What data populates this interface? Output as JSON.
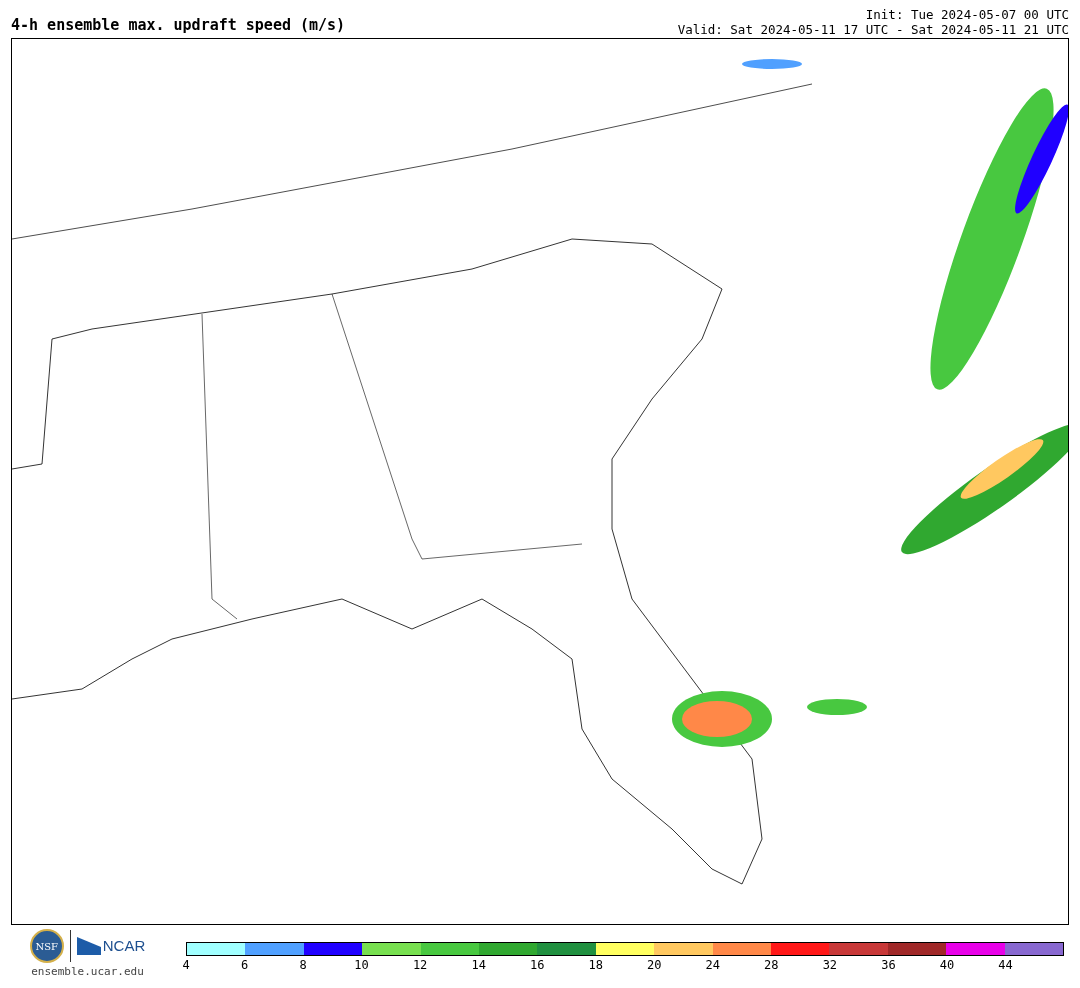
{
  "title": "4-h ensemble max. updraft speed (m/s)",
  "init": "Init: Tue 2024-05-07 00 UTC",
  "valid": "Valid: Sat 2024-05-11 17 UTC - Sat 2024-05-11 21 UTC",
  "logos": {
    "nsf": "NSF",
    "ncar": "NCAR",
    "site": "ensemble.ucar.edu"
  },
  "colorbar": {
    "swatches": [
      {
        "color": "#a0ffff"
      },
      {
        "color": "#50a0ff"
      },
      {
        "color": "#2000ff"
      },
      {
        "color": "#78e050"
      },
      {
        "color": "#48c840"
      },
      {
        "color": "#30a830"
      },
      {
        "color": "#209040"
      },
      {
        "color": "#ffff60"
      },
      {
        "color": "#ffc860"
      },
      {
        "color": "#ff8848"
      },
      {
        "color": "#ff1818"
      },
      {
        "color": "#c83838"
      },
      {
        "color": "#a02828"
      },
      {
        "color": "#e800e8"
      },
      {
        "color": "#8868d0"
      }
    ],
    "ticks": [
      "4",
      "6",
      "8",
      "10",
      "12",
      "14",
      "16",
      "18",
      "20",
      "24",
      "28",
      "32",
      "36",
      "40",
      "44"
    ]
  }
}
